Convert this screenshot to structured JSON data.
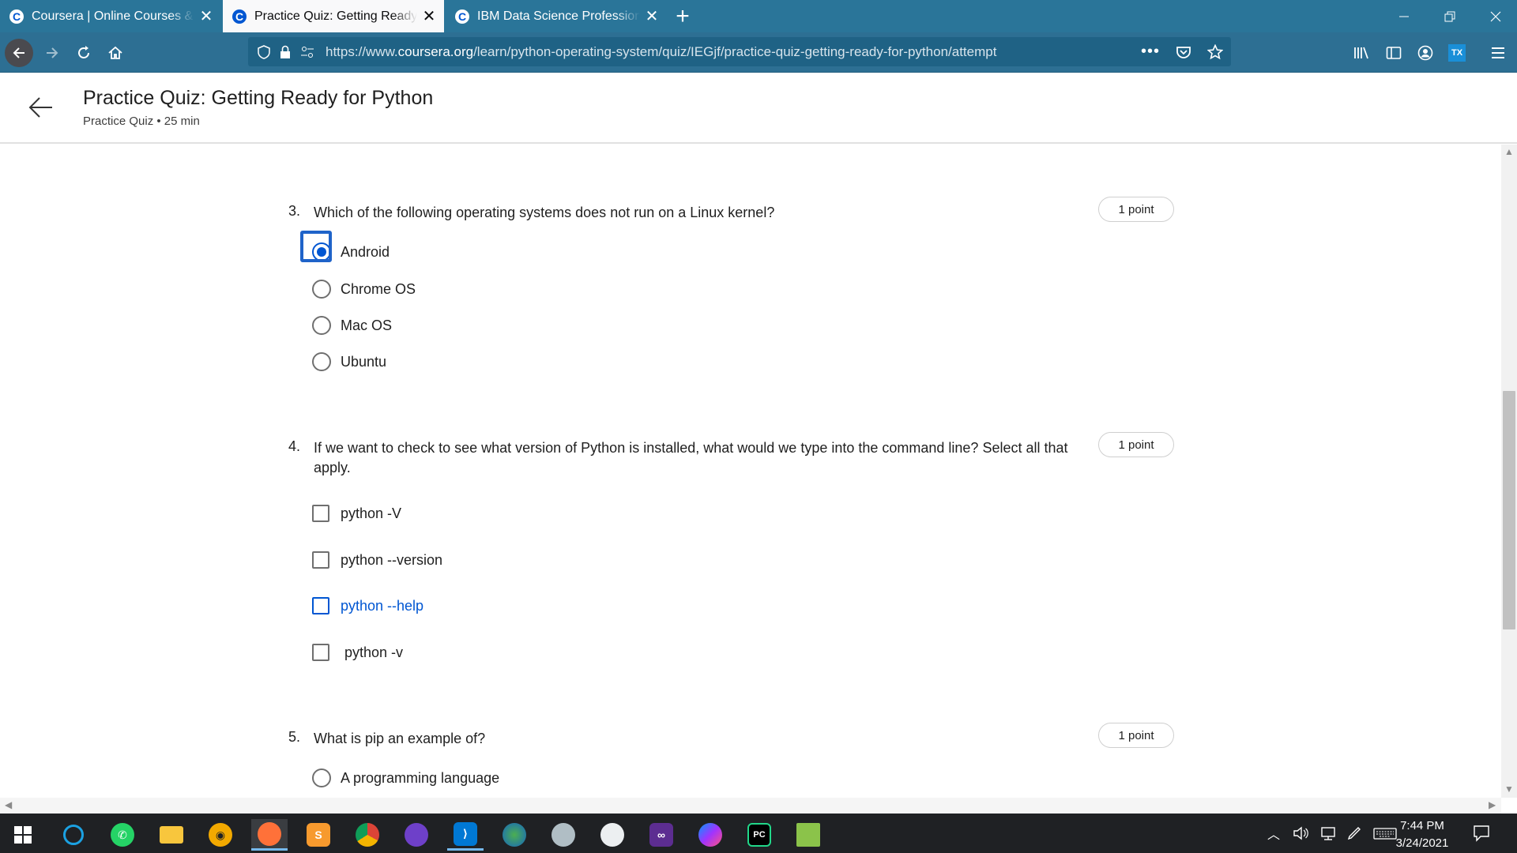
{
  "browser": {
    "tabs": [
      {
        "title": "Coursera | Online Courses & Credentials",
        "active": false
      },
      {
        "title": "Practice Quiz: Getting Ready for Python | Coursera",
        "active": true
      },
      {
        "title": "IBM Data Science Professional Certificate",
        "active": false
      }
    ],
    "favicon_letter": "C",
    "url": {
      "prefix": "https://www.",
      "domain": "coursera.org",
      "path": "/learn/python-operating-system/quiz/IEGjf/practice-quiz-getting-ready-for-python/attempt"
    },
    "colors": {
      "tabbar": "#2a7599",
      "navbar": "#2d6f93",
      "coursera_blue": "#0056d2"
    }
  },
  "page": {
    "title": "Practice Quiz: Getting Ready for Python",
    "subtitle": "Practice Quiz • 25 min"
  },
  "questions": [
    {
      "number": "3.",
      "text": "Which of the following operating systems does not run on a Linux kernel?",
      "points": "1 point",
      "type": "radio",
      "options": [
        {
          "label": "Android",
          "selected": true
        },
        {
          "label": "Chrome OS",
          "selected": false
        },
        {
          "label": "Mac OS",
          "selected": false
        },
        {
          "label": "Ubuntu",
          "selected": false
        }
      ]
    },
    {
      "number": "4.",
      "text": "If we want to check to see  what version of Python is installed, what would we type into the command line? Select all that apply.",
      "points": "1 point",
      "type": "checkbox",
      "options": [
        {
          "label": "python -V",
          "checked": false
        },
        {
          "label": "python --version",
          "checked": false
        },
        {
          "label": "python --help",
          "checked": false,
          "hovered": true
        },
        {
          "label": " python -v",
          "checked": false
        }
      ]
    },
    {
      "number": "5.",
      "text": "What is pip an example of?",
      "points": "1 point",
      "type": "radio",
      "options": [
        {
          "label": "A programming language",
          "selected": false
        }
      ]
    }
  ],
  "taskbar": {
    "apps": [
      "start-icon",
      "sync-icon",
      "whatsapp-icon",
      "file-explorer-icon",
      "vpn-icon",
      "firefox-icon",
      "sublime-icon",
      "chrome-icon",
      "github-desktop-icon",
      "vscode-icon",
      "earth-icon",
      "disk-icon",
      "satellite-icon",
      "visual-studio-icon",
      "messenger-icon",
      "pycharm-icon",
      "notepad-icon"
    ],
    "time": "7:44 PM",
    "date": "3/24/2021"
  }
}
